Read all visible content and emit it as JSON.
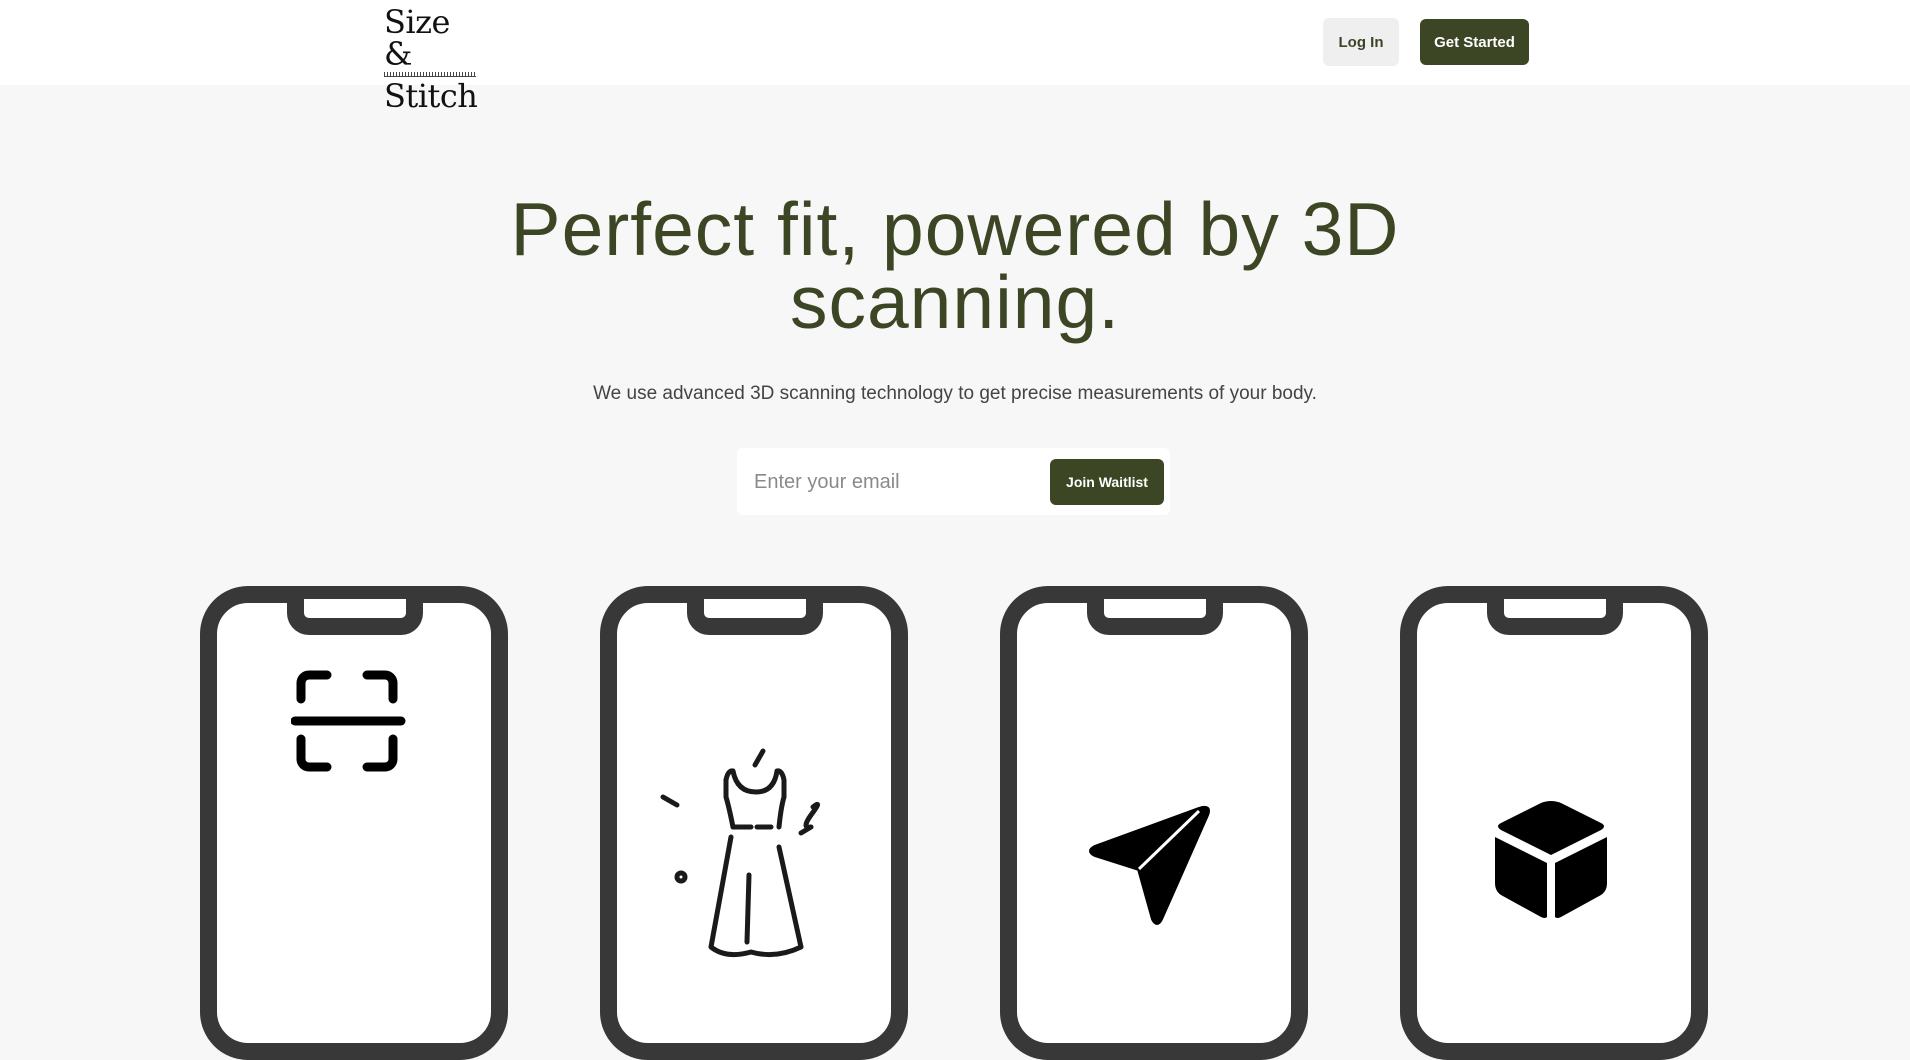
{
  "header": {
    "logo_line1": "Size &",
    "logo_line2": "Stitch",
    "login_label": "Log In",
    "get_started_label": "Get Started"
  },
  "hero": {
    "title": "Perfect fit, powered by 3D scanning.",
    "subtitle": "We use advanced 3D scanning technology to get precise measurements of your body."
  },
  "signup": {
    "email_placeholder": "Enter your email",
    "join_label": "Join Waitlist"
  },
  "phones": [
    {
      "icon": "scan-icon"
    },
    {
      "icon": "dress-icon"
    },
    {
      "icon": "paper-plane-icon"
    },
    {
      "icon": "cube-icon"
    }
  ],
  "colors": {
    "brand": "#3c4624",
    "phone_frame": "#383838",
    "background": "#f7f7f7"
  }
}
